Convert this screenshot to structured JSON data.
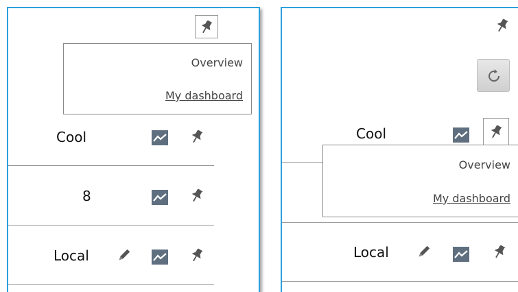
{
  "rows": {
    "cool": "Cool",
    "eight": "8",
    "local": "Local"
  },
  "popup": {
    "overview": "Overview",
    "my_dashboard": "My dashboard"
  },
  "icons": {
    "pin": "pin-icon",
    "chart": "chart-icon",
    "pencil": "pencil-icon",
    "refresh": "refresh-icon"
  },
  "colors": {
    "panel_border": "#2ba0dd",
    "icon": "#555555"
  }
}
